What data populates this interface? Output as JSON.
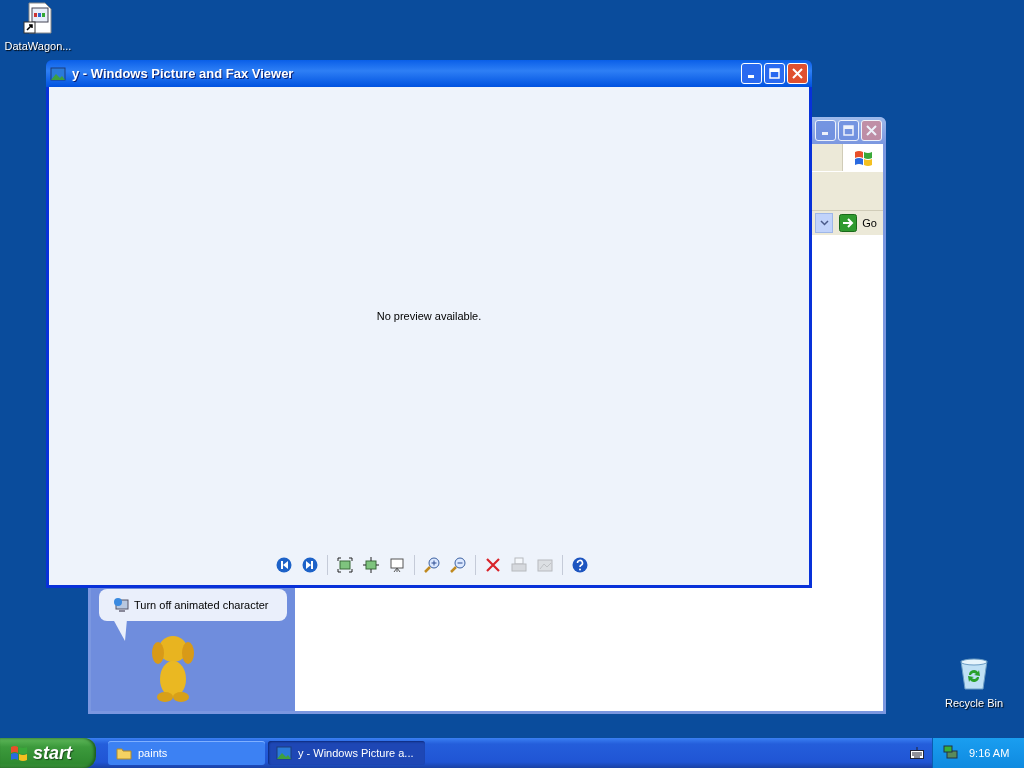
{
  "desktop_icons": [
    {
      "label": "DataWagon...",
      "kind": "shortcut"
    },
    {
      "label": "Recycle Bin",
      "kind": "recycle"
    }
  ],
  "background_window": {
    "go_button": "Go",
    "assistant_bubble": {
      "items": [
        "Turn off animated character"
      ]
    }
  },
  "viewer_window": {
    "title": "y - Windows Picture and Fax Viewer",
    "message": "No preview available.",
    "toolbar_groups": [
      [
        {
          "kind": "previous",
          "disabled": false
        },
        {
          "kind": "next",
          "disabled": false
        }
      ],
      [
        {
          "kind": "best-fit",
          "disabled": false
        },
        {
          "kind": "actual-size",
          "disabled": false
        },
        {
          "kind": "slideshow",
          "disabled": false
        }
      ],
      [
        {
          "kind": "zoom-in",
          "disabled": false
        },
        {
          "kind": "zoom-out",
          "disabled": false
        }
      ],
      [
        {
          "kind": "delete",
          "disabled": false
        },
        {
          "kind": "print",
          "disabled": true
        },
        {
          "kind": "copy",
          "disabled": true
        }
      ],
      [
        {
          "kind": "help",
          "disabled": false
        }
      ]
    ]
  },
  "taskbar": {
    "start": "start",
    "tasks": [
      {
        "label": "paints",
        "kind": "folder",
        "selected": false
      },
      {
        "label": "y - Windows Picture a...",
        "kind": "image",
        "selected": true
      }
    ],
    "clock": "9:16 AM"
  }
}
